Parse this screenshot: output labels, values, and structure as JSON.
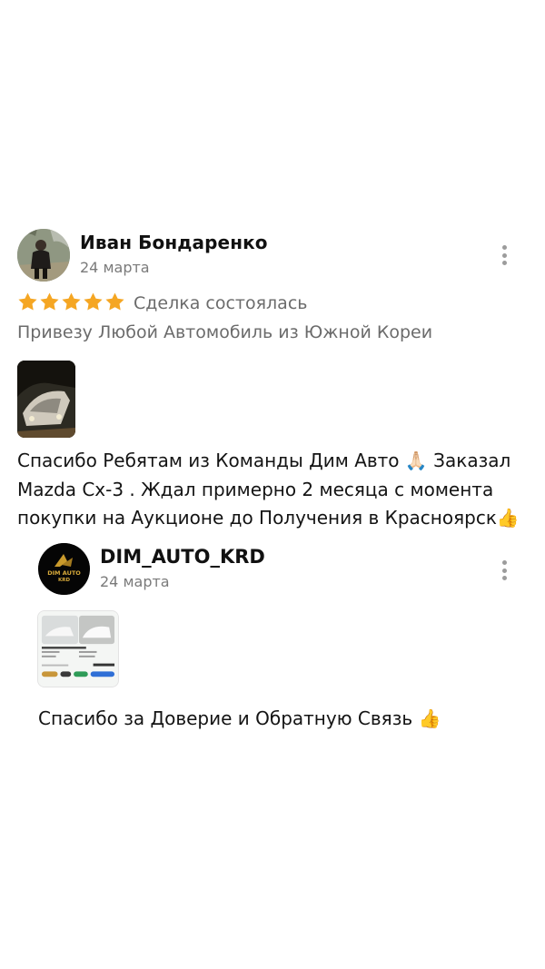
{
  "review": {
    "author": "Иван Бондаренко",
    "date": "24 марта",
    "rating": 5,
    "status": "Сделка состоялась",
    "organization": "Привезу Любой Автомобиль из Южной Кореи",
    "text_lines": [
      "Спасибо Ребятам из Команды Дим Авто 🙏🏻 Заказал",
      "Mazda Cx-3 . Ждал примерно 2 месяца с момента",
      "покупки на Аукционе до Получения в Красноярск👍"
    ],
    "star_color": "#f5a623"
  },
  "reply": {
    "author": "DIM_AUTO_KRD",
    "date": "24 марта",
    "avatar_text": "DIM AUTO KRD",
    "text": "Спасибо за Доверие и Обратную Связь 👍"
  }
}
